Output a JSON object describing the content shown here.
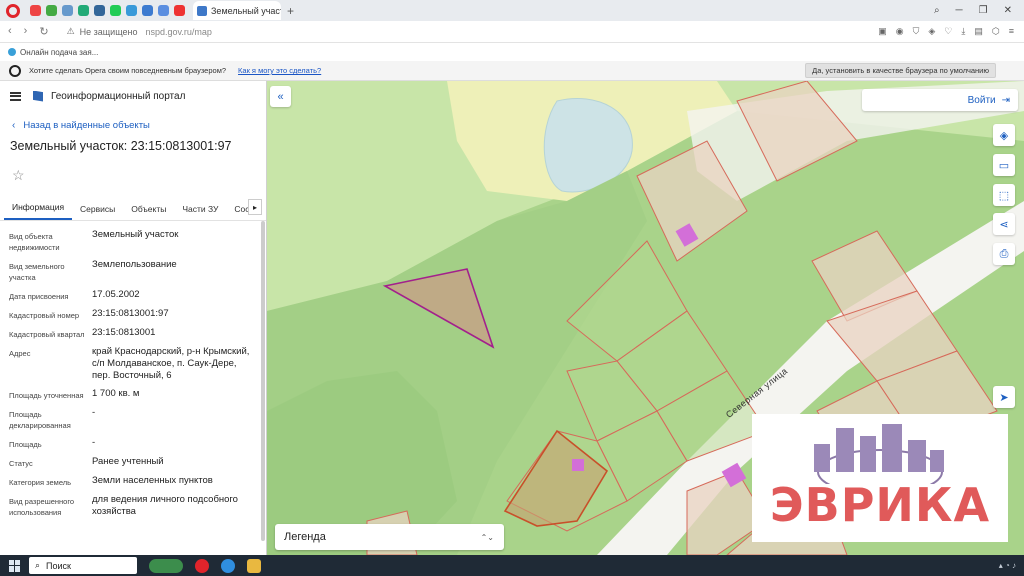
{
  "browser": {
    "tab_title": "Земельный участок, Кр",
    "new_tab": "+",
    "url_security": "Не защищено",
    "url_host": "nspd.gov.ru/map",
    "bookmark": "Онлайн подача зая...",
    "infobar": {
      "question": "Хотите сделать Opera своим повседневным браузером?",
      "link": "Как я могу это сделать?",
      "button": "Да, установить в качестве браузера по умолчанию"
    }
  },
  "portal": {
    "name": "Геоинформационный портал",
    "back": "Назад в найденные объекты",
    "title": "Земельный участок: 23:15:0813001:97"
  },
  "tabs": [
    "Информация",
    "Сервисы",
    "Объекты",
    "Части ЗУ",
    "Соста"
  ],
  "props": [
    {
      "k": "Вид объекта недвижимости",
      "v": "Земельный участок"
    },
    {
      "k": "Вид земельного участка",
      "v": "Землепользование"
    },
    {
      "k": "Дата присвоения",
      "v": "17.05.2002"
    },
    {
      "k": "Кадастровый номер",
      "v": "23:15:0813001:97"
    },
    {
      "k": "Кадастровый квартал",
      "v": "23:15:0813001"
    },
    {
      "k": "Адрес",
      "v": "край Краснодарский, р-н Крымский, с/п Молдаванское, п. Саук-Дере, пер. Восточный, 6"
    },
    {
      "k": "Площадь уточненная",
      "v": "1 700 кв. м"
    },
    {
      "k": "Площадь декларированная",
      "v": "-"
    },
    {
      "k": "Площадь",
      "v": "-"
    },
    {
      "k": "Статус",
      "v": "Ранее учтенный"
    },
    {
      "k": "Категория земель",
      "v": "Земли населенных пунктов"
    },
    {
      "k": "Вид разрешенного использования",
      "v": "для ведения личного подсобного хозяйства"
    }
  ],
  "map": {
    "login": "Войти",
    "legend": "Легенда",
    "street": "Северная улица"
  },
  "watermark": "ЭВРИКА",
  "taskbar": {
    "search": "Поиск"
  },
  "colors": {
    "accent": "#1d5fc1",
    "map_green": "#a9d38a",
    "parcel_red": "#d9534f"
  }
}
